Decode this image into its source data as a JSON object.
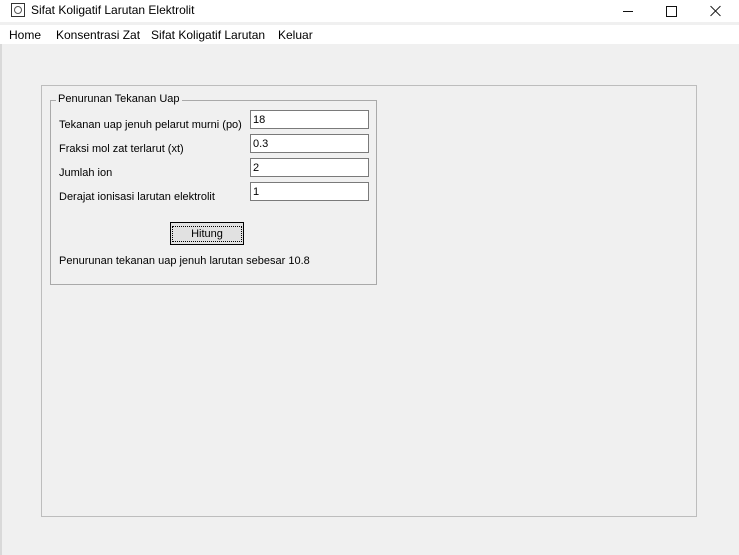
{
  "window": {
    "title": "Sifat Koligatif Larutan Elektrolit",
    "icon": "app-icon"
  },
  "menu": {
    "items": [
      "Home",
      "Konsentrasi Zat",
      "Sifat Koligatif Larutan",
      "Keluar"
    ]
  },
  "form": {
    "group_title": "Penurunan Tekanan Uap",
    "fields": [
      {
        "label": "Tekanan uap jenuh pelarut murni (po)",
        "value": "18"
      },
      {
        "label": "Fraksi mol zat terlarut (xt)",
        "value": "0.3"
      },
      {
        "label": "Jumlah ion",
        "value": "2"
      },
      {
        "label": "Derajat ionisasi larutan elektrolit",
        "value": "1"
      }
    ],
    "button_label": "Hitung",
    "result_text": "Penurunan tekanan uap jenuh larutan sebesar 10.8"
  }
}
